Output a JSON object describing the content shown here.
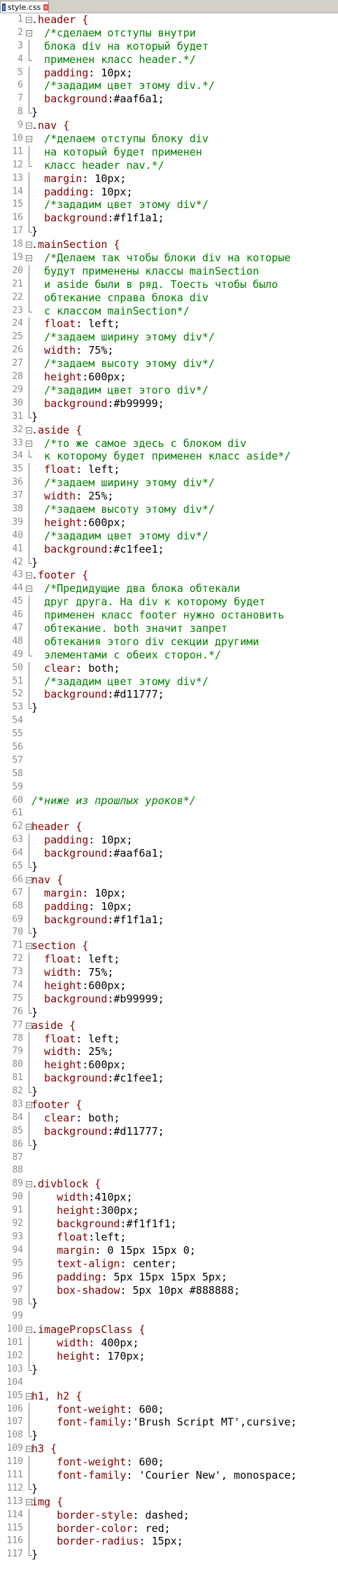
{
  "tab": {
    "filename": "style.css",
    "icon": "css-file-icon",
    "close": "×"
  },
  "colors": {
    "selector": "#800000",
    "comment": "#008000",
    "linenum": "#8a8a8a"
  },
  "lines": [
    {
      "n": "1",
      "f": "box",
      "c": [
        {
          "t": ".header {",
          "k": "sel"
        }
      ]
    },
    {
      "n": "2",
      "f": "box",
      "c": [
        {
          "t": "  /*сделаем отступы внутри",
          "k": "cmt"
        }
      ]
    },
    {
      "n": "3",
      "f": "vline",
      "c": [
        {
          "t": "  блока div на который будет",
          "k": "cmt"
        }
      ]
    },
    {
      "n": "4",
      "f": "end",
      "c": [
        {
          "t": "  применен класс header.*/",
          "k": "cmt"
        }
      ]
    },
    {
      "n": "5",
      "f": "vline",
      "c": [
        {
          "t": "  padding",
          "k": "prop"
        },
        {
          "t": ": 10px;",
          "k": "val"
        }
      ]
    },
    {
      "n": "6",
      "f": "vline",
      "c": [
        {
          "t": "  /*зададим цвет этому div.*/",
          "k": "cmt"
        }
      ]
    },
    {
      "n": "7",
      "f": "vline",
      "c": [
        {
          "t": "  background",
          "k": "prop"
        },
        {
          "t": ":#aaf6a1;",
          "k": "val"
        }
      ]
    },
    {
      "n": "8",
      "f": "end",
      "c": [
        {
          "t": "}",
          "k": "val"
        }
      ]
    },
    {
      "n": "9",
      "f": "box",
      "c": [
        {
          "t": ".nav {",
          "k": "sel"
        }
      ]
    },
    {
      "n": "10",
      "f": "box",
      "c": [
        {
          "t": "  /*делаем отступы блоку div",
          "k": "cmt"
        }
      ]
    },
    {
      "n": "11",
      "f": "vline",
      "c": [
        {
          "t": "  на который будет применен",
          "k": "cmt"
        }
      ]
    },
    {
      "n": "12",
      "f": "end",
      "c": [
        {
          "t": "  класс header nav.*/",
          "k": "cmt"
        }
      ]
    },
    {
      "n": "13",
      "f": "vline",
      "c": [
        {
          "t": "  margin",
          "k": "prop"
        },
        {
          "t": ": 10px;",
          "k": "val"
        }
      ]
    },
    {
      "n": "14",
      "f": "vline",
      "c": [
        {
          "t": "  padding",
          "k": "prop"
        },
        {
          "t": ": 10px;",
          "k": "val"
        }
      ]
    },
    {
      "n": "15",
      "f": "vline",
      "c": [
        {
          "t": "  /*зададим цвет этому div*/",
          "k": "cmt"
        }
      ]
    },
    {
      "n": "16",
      "f": "vline",
      "c": [
        {
          "t": "  background",
          "k": "prop"
        },
        {
          "t": ":#f1f1a1;",
          "k": "val"
        }
      ]
    },
    {
      "n": "17",
      "f": "end",
      "c": [
        {
          "t": "}",
          "k": "val"
        }
      ]
    },
    {
      "n": "18",
      "f": "box",
      "c": [
        {
          "t": ".mainSection {",
          "k": "sel"
        }
      ]
    },
    {
      "n": "19",
      "f": "box",
      "c": [
        {
          "t": "  /*Делаем так чтобы блоки div на которые",
          "k": "cmt"
        }
      ]
    },
    {
      "n": "20",
      "f": "vline",
      "c": [
        {
          "t": "  будут применены классы mainSection",
          "k": "cmt"
        }
      ]
    },
    {
      "n": "21",
      "f": "vline",
      "c": [
        {
          "t": "  и aside были в ряд. Тоесть чтобы было",
          "k": "cmt"
        }
      ]
    },
    {
      "n": "22",
      "f": "vline",
      "c": [
        {
          "t": "  обтекание справа блока div",
          "k": "cmt"
        }
      ]
    },
    {
      "n": "23",
      "f": "end",
      "c": [
        {
          "t": "  с классом mainSection*/",
          "k": "cmt"
        }
      ]
    },
    {
      "n": "24",
      "f": "vline",
      "c": [
        {
          "t": "  float",
          "k": "prop"
        },
        {
          "t": ": left;",
          "k": "val"
        }
      ]
    },
    {
      "n": "25",
      "f": "vline",
      "c": [
        {
          "t": "  /*задаем ширину этому div*/",
          "k": "cmt"
        }
      ]
    },
    {
      "n": "26",
      "f": "vline",
      "c": [
        {
          "t": "  width",
          "k": "prop"
        },
        {
          "t": ": 75%;",
          "k": "val"
        }
      ]
    },
    {
      "n": "27",
      "f": "vline",
      "c": [
        {
          "t": "  /*задаем высоту этому div*/",
          "k": "cmt"
        }
      ]
    },
    {
      "n": "28",
      "f": "vline",
      "c": [
        {
          "t": "  height",
          "k": "prop"
        },
        {
          "t": ":600px;",
          "k": "val"
        }
      ]
    },
    {
      "n": "29",
      "f": "vline",
      "c": [
        {
          "t": "  /*зададим цвет этого div*/",
          "k": "cmt"
        }
      ]
    },
    {
      "n": "30",
      "f": "vline",
      "c": [
        {
          "t": "  background",
          "k": "prop"
        },
        {
          "t": ":#b99999;",
          "k": "val"
        }
      ]
    },
    {
      "n": "31",
      "f": "end",
      "c": [
        {
          "t": "}",
          "k": "val"
        }
      ]
    },
    {
      "n": "32",
      "f": "box",
      "c": [
        {
          "t": ".aside {",
          "k": "sel"
        }
      ]
    },
    {
      "n": "33",
      "f": "box",
      "c": [
        {
          "t": "  /*то же самое здесь с блоком div",
          "k": "cmt"
        }
      ]
    },
    {
      "n": "34",
      "f": "end",
      "c": [
        {
          "t": "  к которому будет применен класс aside*/",
          "k": "cmt"
        }
      ]
    },
    {
      "n": "35",
      "f": "vline",
      "c": [
        {
          "t": "  float",
          "k": "prop"
        },
        {
          "t": ": left;",
          "k": "val"
        }
      ]
    },
    {
      "n": "36",
      "f": "vline",
      "c": [
        {
          "t": "  /*задаем ширину этому div*/",
          "k": "cmt"
        }
      ]
    },
    {
      "n": "37",
      "f": "vline",
      "c": [
        {
          "t": "  width",
          "k": "prop"
        },
        {
          "t": ": 25%;",
          "k": "val"
        }
      ]
    },
    {
      "n": "38",
      "f": "vline",
      "c": [
        {
          "t": "  /*задаем высоту этому div*/",
          "k": "cmt"
        }
      ]
    },
    {
      "n": "39",
      "f": "vline",
      "c": [
        {
          "t": "  height",
          "k": "prop"
        },
        {
          "t": ":600px;",
          "k": "val"
        }
      ]
    },
    {
      "n": "40",
      "f": "vline",
      "c": [
        {
          "t": "  /*зададим цвет этому div*/",
          "k": "cmt"
        }
      ]
    },
    {
      "n": "41",
      "f": "vline",
      "c": [
        {
          "t": "  background",
          "k": "prop"
        },
        {
          "t": ":#c1fee1;",
          "k": "val"
        }
      ]
    },
    {
      "n": "42",
      "f": "end",
      "c": [
        {
          "t": "}",
          "k": "val"
        }
      ]
    },
    {
      "n": "43",
      "f": "box",
      "c": [
        {
          "t": ".footer {",
          "k": "sel"
        }
      ]
    },
    {
      "n": "44",
      "f": "box",
      "c": [
        {
          "t": "  /*Предидущие два блока обтекали",
          "k": "cmt"
        }
      ]
    },
    {
      "n": "45",
      "f": "vline",
      "c": [
        {
          "t": "  друг друга. На div к которому будет",
          "k": "cmt"
        }
      ]
    },
    {
      "n": "46",
      "f": "vline",
      "c": [
        {
          "t": "  применен класс footer нужно остановить",
          "k": "cmt"
        }
      ]
    },
    {
      "n": "47",
      "f": "vline",
      "c": [
        {
          "t": "  обтекание. both значит запрет",
          "k": "cmt"
        }
      ]
    },
    {
      "n": "48",
      "f": "vline",
      "c": [
        {
          "t": "  обтекания этого div секции другими",
          "k": "cmt"
        }
      ]
    },
    {
      "n": "49",
      "f": "end",
      "c": [
        {
          "t": "  элементами с обеих сторон.*/",
          "k": "cmt"
        }
      ]
    },
    {
      "n": "50",
      "f": "vline",
      "c": [
        {
          "t": "  clear",
          "k": "prop"
        },
        {
          "t": ": both;",
          "k": "val"
        }
      ]
    },
    {
      "n": "51",
      "f": "vline",
      "c": [
        {
          "t": "  /*зададим цвет этому div*/",
          "k": "cmt"
        }
      ]
    },
    {
      "n": "52",
      "f": "vline",
      "c": [
        {
          "t": "  background",
          "k": "prop"
        },
        {
          "t": ":#d11777;",
          "k": "val"
        }
      ]
    },
    {
      "n": "53",
      "f": "end",
      "c": [
        {
          "t": "}",
          "k": "val"
        }
      ]
    },
    {
      "n": "54",
      "f": "",
      "c": []
    },
    {
      "n": "55",
      "f": "",
      "c": []
    },
    {
      "n": "56",
      "f": "",
      "c": []
    },
    {
      "n": "57",
      "f": "",
      "c": []
    },
    {
      "n": "58",
      "f": "",
      "c": []
    },
    {
      "n": "59",
      "f": "",
      "c": []
    },
    {
      "n": "60",
      "f": "",
      "c": [
        {
          "t": "/*ниже из прошлых уроков*/",
          "k": "cmt"
        }
      ]
    },
    {
      "n": "61",
      "f": "",
      "c": []
    },
    {
      "n": "62",
      "f": "box",
      "c": [
        {
          "t": "header {",
          "k": "sel"
        }
      ]
    },
    {
      "n": "63",
      "f": "vline",
      "c": [
        {
          "t": "  padding",
          "k": "prop"
        },
        {
          "t": ": 10px;",
          "k": "val"
        }
      ]
    },
    {
      "n": "64",
      "f": "vline",
      "c": [
        {
          "t": "  background",
          "k": "prop"
        },
        {
          "t": ":#aaf6a1;",
          "k": "val"
        }
      ]
    },
    {
      "n": "65",
      "f": "end",
      "c": [
        {
          "t": "}",
          "k": "val"
        }
      ]
    },
    {
      "n": "66",
      "f": "box",
      "c": [
        {
          "t": "nav {",
          "k": "sel"
        }
      ]
    },
    {
      "n": "67",
      "f": "vline",
      "c": [
        {
          "t": "  margin",
          "k": "prop"
        },
        {
          "t": ": 10px;",
          "k": "val"
        }
      ]
    },
    {
      "n": "68",
      "f": "vline",
      "c": [
        {
          "t": "  padding",
          "k": "prop"
        },
        {
          "t": ": 10px;",
          "k": "val"
        }
      ]
    },
    {
      "n": "69",
      "f": "vline",
      "c": [
        {
          "t": "  background",
          "k": "prop"
        },
        {
          "t": ":#f1f1a1;",
          "k": "val"
        }
      ]
    },
    {
      "n": "70",
      "f": "end",
      "c": [
        {
          "t": "}",
          "k": "val"
        }
      ]
    },
    {
      "n": "71",
      "f": "box",
      "c": [
        {
          "t": "section {",
          "k": "sel"
        }
      ]
    },
    {
      "n": "72",
      "f": "vline",
      "c": [
        {
          "t": "  float",
          "k": "prop"
        },
        {
          "t": ": left;",
          "k": "val"
        }
      ]
    },
    {
      "n": "73",
      "f": "vline",
      "c": [
        {
          "t": "  width",
          "k": "prop"
        },
        {
          "t": ": 75%;",
          "k": "val"
        }
      ]
    },
    {
      "n": "74",
      "f": "vline",
      "c": [
        {
          "t": "  height",
          "k": "prop"
        },
        {
          "t": ":600px;",
          "k": "val"
        }
      ]
    },
    {
      "n": "75",
      "f": "vline",
      "c": [
        {
          "t": "  background",
          "k": "prop"
        },
        {
          "t": ":#b99999;",
          "k": "val"
        }
      ]
    },
    {
      "n": "76",
      "f": "end",
      "c": [
        {
          "t": "}",
          "k": "val"
        }
      ]
    },
    {
      "n": "77",
      "f": "box",
      "c": [
        {
          "t": "aside {",
          "k": "sel"
        }
      ]
    },
    {
      "n": "78",
      "f": "vline",
      "c": [
        {
          "t": "  float",
          "k": "prop"
        },
        {
          "t": ": left;",
          "k": "val"
        }
      ]
    },
    {
      "n": "79",
      "f": "vline",
      "c": [
        {
          "t": "  width",
          "k": "prop"
        },
        {
          "t": ": 25%;",
          "k": "val"
        }
      ]
    },
    {
      "n": "80",
      "f": "vline",
      "c": [
        {
          "t": "  height",
          "k": "prop"
        },
        {
          "t": ":600px;",
          "k": "val"
        }
      ]
    },
    {
      "n": "81",
      "f": "vline",
      "c": [
        {
          "t": "  background",
          "k": "prop"
        },
        {
          "t": ":#c1fee1;",
          "k": "val"
        }
      ]
    },
    {
      "n": "82",
      "f": "end",
      "c": [
        {
          "t": "}",
          "k": "val"
        }
      ]
    },
    {
      "n": "83",
      "f": "box",
      "c": [
        {
          "t": "footer {",
          "k": "sel"
        }
      ]
    },
    {
      "n": "84",
      "f": "vline",
      "c": [
        {
          "t": "  clear",
          "k": "prop"
        },
        {
          "t": ": both;",
          "k": "val"
        }
      ]
    },
    {
      "n": "85",
      "f": "vline",
      "c": [
        {
          "t": "  background",
          "k": "prop"
        },
        {
          "t": ":#d11777;",
          "k": "val"
        }
      ]
    },
    {
      "n": "86",
      "f": "end",
      "c": [
        {
          "t": "}",
          "k": "val"
        }
      ]
    },
    {
      "n": "87",
      "f": "",
      "c": []
    },
    {
      "n": "88",
      "f": "",
      "c": []
    },
    {
      "n": "89",
      "f": "box",
      "c": [
        {
          "t": ".divblock {",
          "k": "sel"
        }
      ]
    },
    {
      "n": "90",
      "f": "vline",
      "c": [
        {
          "t": "    width",
          "k": "prop"
        },
        {
          "t": ":410px;",
          "k": "val"
        }
      ]
    },
    {
      "n": "91",
      "f": "vline",
      "c": [
        {
          "t": "    height",
          "k": "prop"
        },
        {
          "t": ":300px;",
          "k": "val"
        }
      ]
    },
    {
      "n": "92",
      "f": "vline",
      "c": [
        {
          "t": "    background",
          "k": "prop"
        },
        {
          "t": ":#f1f1f1;",
          "k": "val"
        }
      ]
    },
    {
      "n": "93",
      "f": "vline",
      "c": [
        {
          "t": "    float",
          "k": "prop"
        },
        {
          "t": ":left;",
          "k": "val"
        }
      ]
    },
    {
      "n": "94",
      "f": "vline",
      "c": [
        {
          "t": "    margin",
          "k": "prop"
        },
        {
          "t": ": 0 15px 15px 0;",
          "k": "val"
        }
      ]
    },
    {
      "n": "95",
      "f": "vline",
      "c": [
        {
          "t": "    text-align",
          "k": "prop"
        },
        {
          "t": ": center;",
          "k": "val"
        }
      ]
    },
    {
      "n": "96",
      "f": "vline",
      "c": [
        {
          "t": "    padding",
          "k": "prop"
        },
        {
          "t": ": 5px 15px 15px 5px;",
          "k": "val"
        }
      ]
    },
    {
      "n": "97",
      "f": "vline",
      "c": [
        {
          "t": "    box-shadow",
          "k": "prop"
        },
        {
          "t": ": 5px 10px #888888;",
          "k": "val"
        }
      ]
    },
    {
      "n": "98",
      "f": "end",
      "c": [
        {
          "t": "}",
          "k": "val"
        }
      ]
    },
    {
      "n": "99",
      "f": "",
      "c": []
    },
    {
      "n": "100",
      "f": "box",
      "c": [
        {
          "t": ".imagePropsClass {",
          "k": "sel"
        }
      ]
    },
    {
      "n": "101",
      "f": "vline",
      "c": [
        {
          "t": "    width",
          "k": "prop"
        },
        {
          "t": ": 400px;",
          "k": "val"
        }
      ]
    },
    {
      "n": "102",
      "f": "vline",
      "c": [
        {
          "t": "    height",
          "k": "prop"
        },
        {
          "t": ": 170px;",
          "k": "val"
        }
      ]
    },
    {
      "n": "103",
      "f": "end",
      "c": [
        {
          "t": "}",
          "k": "val"
        }
      ]
    },
    {
      "n": "104",
      "f": "",
      "c": []
    },
    {
      "n": "105",
      "f": "box",
      "c": [
        {
          "t": "h1, h2 {",
          "k": "sel"
        }
      ]
    },
    {
      "n": "106",
      "f": "vline",
      "c": [
        {
          "t": "    font-weight",
          "k": "prop"
        },
        {
          "t": ": 600;",
          "k": "val"
        }
      ]
    },
    {
      "n": "107",
      "f": "vline",
      "c": [
        {
          "t": "    font-family",
          "k": "prop"
        },
        {
          "t": ":'Brush Script MT',cursive;",
          "k": "val"
        }
      ]
    },
    {
      "n": "108",
      "f": "end",
      "c": [
        {
          "t": "}",
          "k": "val"
        }
      ]
    },
    {
      "n": "109",
      "f": "box",
      "c": [
        {
          "t": "h3 {",
          "k": "sel"
        }
      ]
    },
    {
      "n": "110",
      "f": "vline",
      "c": [
        {
          "t": "    font-weight",
          "k": "prop"
        },
        {
          "t": ": 600;",
          "k": "val"
        }
      ]
    },
    {
      "n": "111",
      "f": "vline",
      "c": [
        {
          "t": "    font-family",
          "k": "prop"
        },
        {
          "t": ": 'Courier New', monospace;",
          "k": "val"
        }
      ]
    },
    {
      "n": "112",
      "f": "end",
      "c": [
        {
          "t": "}",
          "k": "val"
        }
      ]
    },
    {
      "n": "113",
      "f": "box",
      "c": [
        {
          "t": "img {",
          "k": "sel"
        }
      ]
    },
    {
      "n": "114",
      "f": "vline",
      "c": [
        {
          "t": "    border-style",
          "k": "prop"
        },
        {
          "t": ": dashed;",
          "k": "val"
        }
      ]
    },
    {
      "n": "115",
      "f": "vline",
      "c": [
        {
          "t": "    border-color",
          "k": "prop"
        },
        {
          "t": ": red;",
          "k": "val"
        }
      ]
    },
    {
      "n": "116",
      "f": "vline",
      "c": [
        {
          "t": "    border-radius",
          "k": "prop"
        },
        {
          "t": ": 15px;",
          "k": "val"
        }
      ]
    },
    {
      "n": "117",
      "f": "end",
      "c": [
        {
          "t": "}",
          "k": "val"
        }
      ]
    }
  ]
}
